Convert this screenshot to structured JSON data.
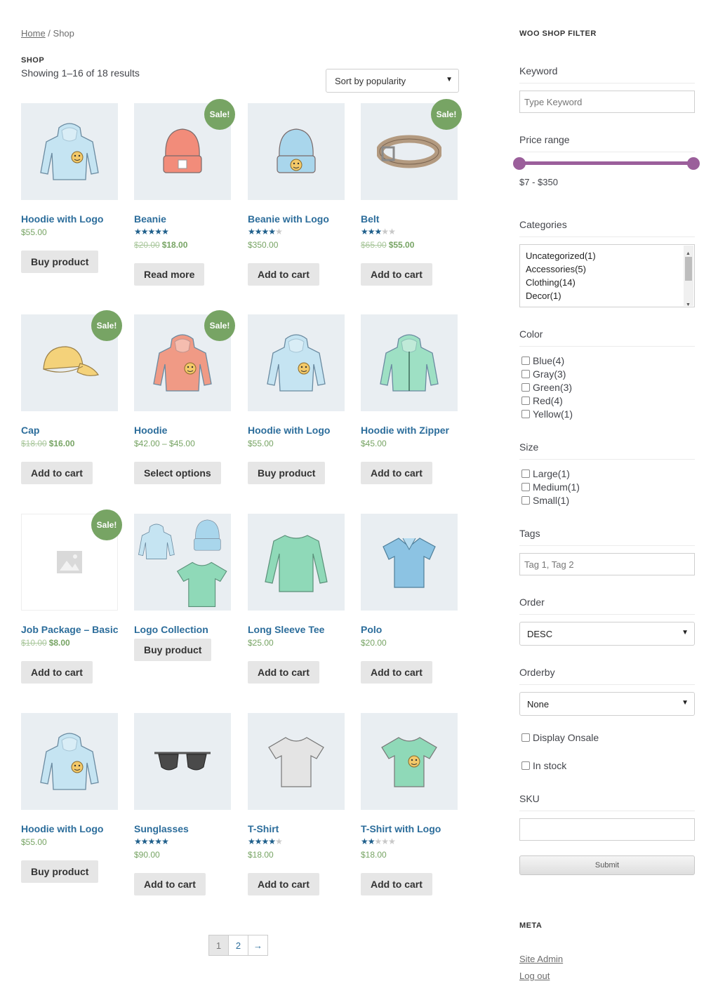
{
  "breadcrumb": {
    "home": "Home",
    "separator": " / ",
    "current": "Shop"
  },
  "shop": {
    "title": "SHOP",
    "result_count": "Showing 1–16 of 18 results",
    "sort": {
      "selected": "Sort by popularity"
    }
  },
  "colors": {
    "link": "#2c6d9b",
    "sale_badge": "#77a464",
    "price": "#77a464",
    "slider": "#9b5f9b",
    "button_bg": "#e6e6e6"
  },
  "products": [
    {
      "title": "Hoodie with Logo",
      "price": "$55.00",
      "button": "Buy product",
      "icon": "hoodie-logo-image"
    },
    {
      "title": "Beanie",
      "sale_badge": "Sale!",
      "rating": 5,
      "old_price": "$20.00",
      "price": "$18.00",
      "button": "Read more",
      "icon": "beanie-image"
    },
    {
      "title": "Beanie with Logo",
      "rating": 4,
      "price": "$350.00",
      "button": "Add to cart",
      "icon": "beanie-logo-image"
    },
    {
      "title": "Belt",
      "sale_badge": "Sale!",
      "rating": 3,
      "old_price": "$65.00",
      "price": "$55.00",
      "button": "Add to cart",
      "icon": "belt-image"
    },
    {
      "title": "Cap",
      "sale_badge": "Sale!",
      "old_price": "$18.00",
      "price": "$16.00",
      "button": "Add to cart",
      "icon": "cap-image"
    },
    {
      "title": "Hoodie",
      "sale_badge": "Sale!",
      "price": "$42.00 – $45.00",
      "button": "Select options",
      "icon": "hoodie-image"
    },
    {
      "title": "Hoodie with Logo",
      "price": "$55.00",
      "button": "Buy product",
      "icon": "hoodie-logo-image"
    },
    {
      "title": "Hoodie with Zipper",
      "price": "$45.00",
      "button": "Add to cart",
      "icon": "hoodie-zipper-image"
    },
    {
      "title": "Job Package – Basic",
      "sale_badge": "Sale!",
      "old_price": "$10.00",
      "price": "$8.00",
      "button": "Add to cart",
      "icon": "placeholder-image"
    },
    {
      "title": "Logo Collection",
      "price": "",
      "button": "Buy product",
      "icon": "logo-collection-image"
    },
    {
      "title": "Long Sleeve Tee",
      "price": "$25.00",
      "button": "Add to cart",
      "icon": "long-sleeve-tee-image"
    },
    {
      "title": "Polo",
      "price": "$20.00",
      "button": "Add to cart",
      "icon": "polo-image"
    },
    {
      "title": "Hoodie with Logo",
      "price": "$55.00",
      "button": "Buy product",
      "icon": "hoodie-logo-image"
    },
    {
      "title": "Sunglasses",
      "rating": 5,
      "price": "$90.00",
      "button": "Add to cart",
      "icon": "sunglasses-image"
    },
    {
      "title": "T-Shirt",
      "rating": 4,
      "price": "$18.00",
      "button": "Add to cart",
      "icon": "tshirt-image"
    },
    {
      "title": "T-Shirt with Logo",
      "rating": 2,
      "price": "$18.00",
      "button": "Add to cart",
      "icon": "tshirt-logo-image"
    }
  ],
  "pagination": {
    "pages": [
      "1",
      "2"
    ],
    "next": "→",
    "current": "1"
  },
  "filter": {
    "title": "WOO SHOP FILTER",
    "keyword_label": "Keyword",
    "keyword_placeholder": "Type Keyword",
    "price_label": "Price range",
    "price_value": "$7 - $350",
    "price_handles": {
      "min": 0,
      "max": 1
    },
    "categories_label": "Categories",
    "categories": [
      "Uncategorized(1)",
      "Accessories(5)",
      "Clothing(14)",
      "Decor(1)"
    ],
    "color_label": "Color",
    "colors": [
      "Blue(4)",
      "Gray(3)",
      "Green(3)",
      "Red(4)",
      "Yellow(1)"
    ],
    "size_label": "Size",
    "sizes": [
      "Large(1)",
      "Medium(1)",
      "Small(1)"
    ],
    "tags_label": "Tags",
    "tags_placeholder": "Tag 1, Tag 2",
    "order_label": "Order",
    "order_value": "DESC",
    "orderby_label": "Orderby",
    "orderby_value": "None",
    "display_onsale": "Display Onsale",
    "in_stock": "In stock",
    "sku_label": "SKU",
    "sku_value": "",
    "submit": "Submit"
  },
  "meta": {
    "title": "META",
    "links": [
      "Site Admin",
      "Log out"
    ]
  }
}
